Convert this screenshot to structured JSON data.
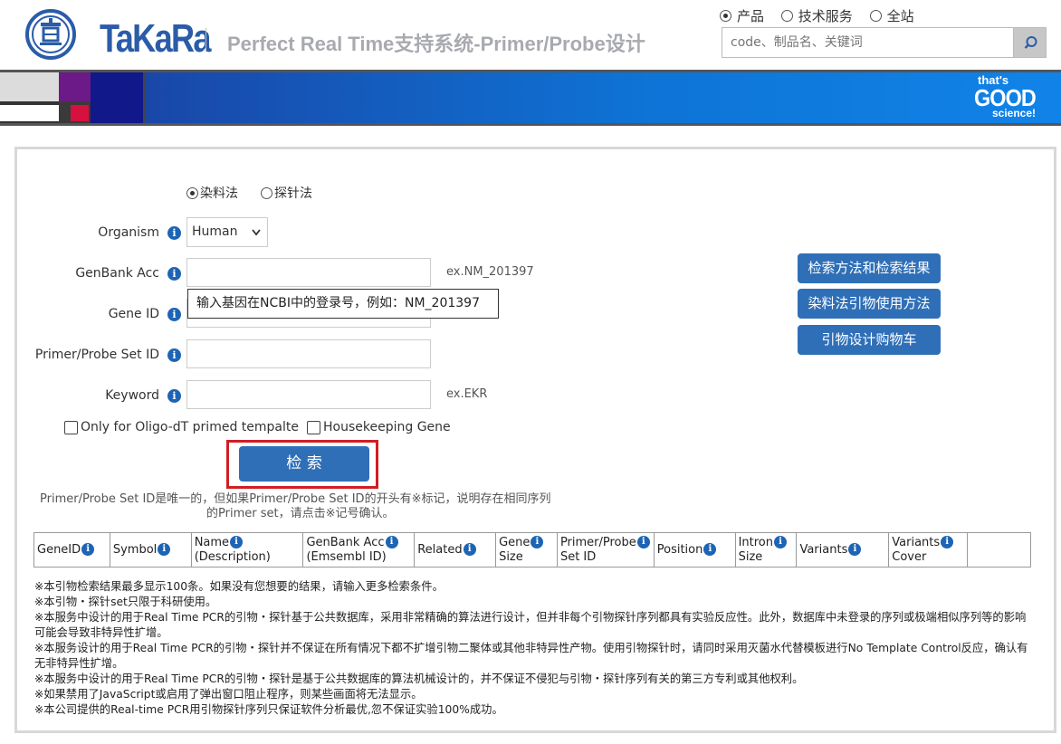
{
  "header": {
    "brand": "TaKaRa",
    "site_title": "Perfect Real Time支持系统-Primer/Probe设计",
    "scope_options": [
      "产品",
      "技术服务",
      "全站"
    ],
    "scope_selected": "产品",
    "search_placeholder": "code、制品名、关键词",
    "banner_tagline": [
      "that's",
      "GOOD",
      "science!"
    ],
    "colors": {
      "brand_blue": "#2a5ca8",
      "banner_blue": "#1183e8"
    }
  },
  "form": {
    "method_options": [
      "染料法",
      "探针法"
    ],
    "method_selected": "染料法",
    "organism_label": "Organism",
    "organism_value": "Human",
    "genbank_label": "GenBank Acc",
    "genbank_hint": "ex.NM_201397",
    "genbank_tooltip": "输入基因在NCBI中的登录号，例如：NM_201397",
    "geneid_label": "Gene ID",
    "primer_set_label": "Primer/Probe Set ID",
    "keyword_label": "Keyword",
    "keyword_hint": "ex.EKR",
    "oligo_dt_label": "Only for Oligo-dT primed tempalte",
    "housekeeping_label": "Housekeeping Gene",
    "search_button": "检 索",
    "note_line1": "Primer/Probe Set ID是唯一的，但如果Primer/Probe Set ID的开头有※标记，说明存在相同序列",
    "note_line2": "的Primer set，请点击※记号确认。"
  },
  "side_buttons": [
    "检索方法和检索结果",
    "染料法引物使用方法",
    "引物设计购物车"
  ],
  "table": {
    "columns": [
      {
        "label": "GeneID",
        "info": true
      },
      {
        "label": "Symbol",
        "info": true
      },
      {
        "label": "Name\n(Description)",
        "info": true
      },
      {
        "label": "GenBank Acc\n(Emsembl ID)",
        "info": true
      },
      {
        "label": "Related",
        "info": true
      },
      {
        "label": "Gene\nSize",
        "info": true
      },
      {
        "label": "Primer/Probe\nSet ID",
        "info": true
      },
      {
        "label": "Position",
        "info": true
      },
      {
        "label": "Intron\nSize",
        "info": true
      },
      {
        "label": "Variants",
        "info": true
      },
      {
        "label": "Variants\nCover",
        "info": true
      },
      {
        "label": "",
        "info": false
      }
    ]
  },
  "notes": [
    "※本引物检索结果最多显示100条。如果没有您想要的结果，请输入更多检索条件。",
    "※本引物・探针set只限于科研使用。",
    "※本服务中设计的用于Real Time PCR的引物・探针基于公共数据库，采用非常精确的算法进行设计，但并非每个引物探针序列都具有实验反应性。此外，数据库中未登录的序列或极端相似序列等的影响可能会导致非特异性扩增。",
    "※本服务设计的用于Real Time PCR的引物・探针并不保证在所有情况下都不扩增引物二聚体或其他非特异性产物。使用引物探针时，请同时采用灭菌水代替模板进行No Template Control反应，确认有无非特异性扩增。",
    "※本服务中设计的用于Real Time PCR的引物・探针是基于公共数据库的算法机械设计的，并不保证不侵犯与引物・探针序列有关的第三方专利或其他权利。",
    "※如果禁用了JavaScript或启用了弹出窗口阻止程序，则某些画面将无法显示。",
    "※本公司提供的Real-time PCR用引物探针序列只保证软件分析最优,忽不保证实验100%成功。"
  ]
}
